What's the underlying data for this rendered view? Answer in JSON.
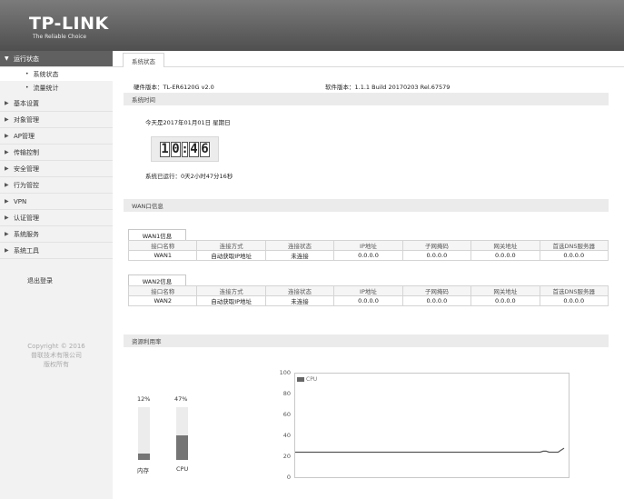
{
  "header": {
    "logo": "TP-LINK",
    "slogan": "The Reliable Choice"
  },
  "sidebar": {
    "active_group": "运行状态",
    "sub_items": [
      "系统状态",
      "流量统计"
    ],
    "items": [
      "基本设置",
      "对象管理",
      "AP管理",
      "传输控制",
      "安全管理",
      "行为管控",
      "VPN",
      "认证管理",
      "系统服务",
      "系统工具"
    ],
    "logout": "退出登录",
    "copyright": [
      "Copyright © 2016",
      "普联技术有限公司",
      "版权所有"
    ]
  },
  "tabs": {
    "active": "系统状态"
  },
  "info": {
    "hardware": "硬件版本：TL-ER6120G v2.0",
    "software": "软件版本：1.1.1 Build 20170203 Rel.67579"
  },
  "system_time": {
    "section_title": "系统时间",
    "date_text": "今天是2017年01月01日 星期日",
    "clock": {
      "h1": "1",
      "h2": "0",
      "sep": ":",
      "m1": "4",
      "m2": "6"
    },
    "uptime": "系统已运行：0天2小时47分16秒"
  },
  "wan": {
    "section_title": "WAN口信息",
    "columns": [
      "接口名称",
      "连接方式",
      "连接状态",
      "IP地址",
      "子网掩码",
      "网关地址",
      "首选DNS服务器"
    ],
    "tables": [
      {
        "tab": "WAN1信息",
        "row": [
          "WAN1",
          "自动获取IP地址",
          "未连接",
          "0.0.0.0",
          "0.0.0.0",
          "0.0.0.0",
          "0.0.0.0"
        ]
      },
      {
        "tab": "WAN2信息",
        "row": [
          "WAN2",
          "自动获取IP地址",
          "未连接",
          "0.0.0.0",
          "0.0.0.0",
          "0.0.0.0",
          "0.0.0.0"
        ]
      }
    ]
  },
  "resources": {
    "section_title": "资源利用率",
    "memory": {
      "label": "内存",
      "percent_text": "12%",
      "value": 12
    },
    "cpu": {
      "label": "CPU",
      "percent_text": "47%",
      "value": 47
    }
  },
  "chart_data": {
    "type": "line",
    "series": [
      {
        "name": "CPU",
        "values": [
          25,
          25,
          25,
          25,
          25,
          25,
          25,
          25,
          25,
          25,
          25,
          25,
          25,
          25,
          25,
          25,
          25,
          25,
          25,
          25,
          25,
          25,
          25,
          25,
          25,
          25,
          25,
          25,
          25,
          25,
          25,
          25,
          25,
          25,
          25,
          25,
          25,
          25,
          25,
          25,
          25,
          25,
          25,
          25,
          25,
          25,
          25,
          25,
          25,
          25,
          25,
          25,
          25,
          25,
          25,
          25,
          25,
          25,
          25,
          25,
          25,
          25,
          25,
          25,
          25,
          25,
          25,
          25,
          25,
          25,
          25,
          25,
          25,
          25,
          25,
          25,
          25,
          25,
          25,
          25,
          25,
          25,
          25,
          26,
          26,
          25,
          25,
          25,
          25,
          27,
          29
        ]
      }
    ],
    "yticks": [
      "100",
      "80",
      "60",
      "40",
      "20",
      "0"
    ],
    "ylim": [
      0,
      100
    ],
    "color": "#555555"
  }
}
